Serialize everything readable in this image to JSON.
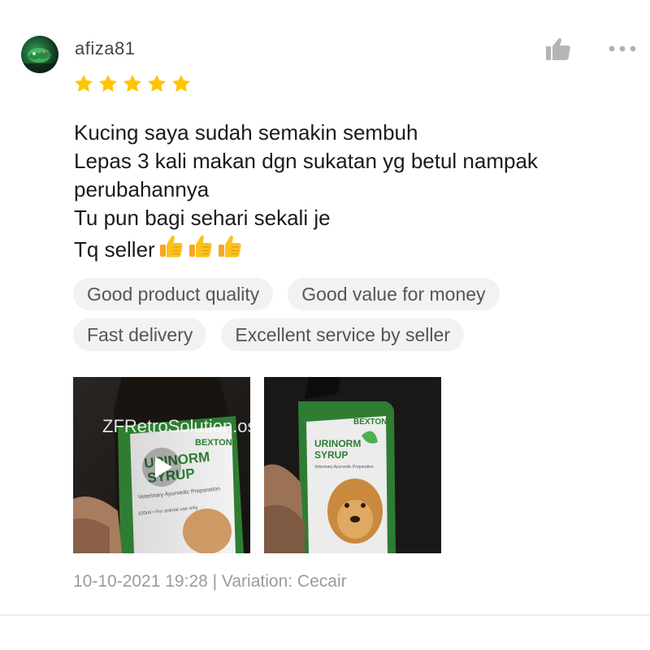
{
  "review": {
    "username": "afiza81",
    "rating": 5,
    "rating_max": 5,
    "star_color": "#FFC400",
    "text_lines": [
      "Kucing saya sudah semakin sembuh",
      "Lepas 3 kali makan dgn sukatan yg betul nampak",
      "perubahannya",
      "Tu pun bagi sehari sekali je",
      "Tq seller"
    ],
    "emoji_icons": [
      "thumbs-up-emoji",
      "thumbs-up-emoji",
      "thumbs-up-emoji"
    ],
    "tags": [
      "Good product quality",
      "Good value for money",
      "Fast delivery",
      "Excellent service by seller"
    ],
    "media": {
      "watermark": "ZFRetroSolution.os",
      "video_icon": "play-icon",
      "items": [
        {
          "type": "video",
          "label_lines": [
            "BEXTON",
            "URINORM",
            "SYRUP",
            "Veterinary Ayurvedic Preparation",
            "100ml • For animal use only"
          ]
        },
        {
          "type": "image",
          "label_lines": [
            "BEXTON",
            "URINORM",
            "SYRUP",
            "Veterinary Ayurvedic Preparation"
          ]
        }
      ]
    },
    "meta": "10-10-2021 19:28 | Variation: Cecair",
    "actions": {
      "like_icon": "thumbs-up-icon",
      "more_icon": "more-options-icon"
    }
  }
}
